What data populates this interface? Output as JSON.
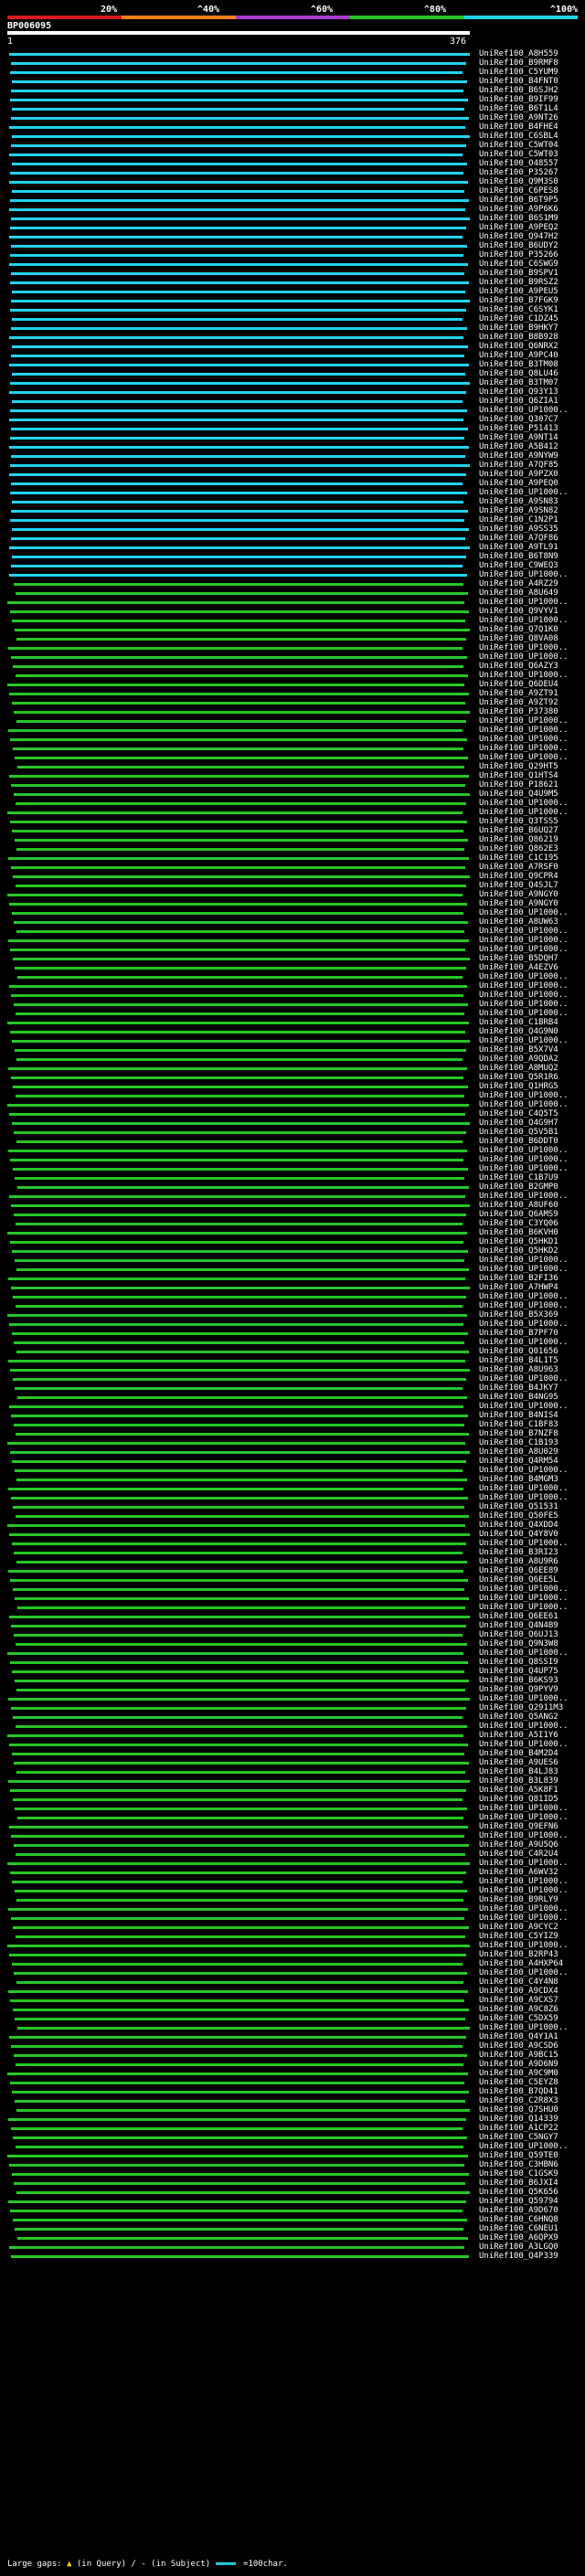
{
  "legend": {
    "labels": [
      "20%",
      "^40%",
      "^60%",
      "^80%",
      "^100%"
    ],
    "colors": [
      "#d81b1b",
      "#f08018",
      "#a93ad0",
      "#26c626",
      "#1fd3ee"
    ]
  },
  "query": {
    "name": "BP006095",
    "ruler_start": "1",
    "ruler_end": "376"
  },
  "hits": [
    "UniRef100_A8H559",
    "UniRef100_B9RMF8",
    "UniRef100_C5YUM9",
    "UniRef100_B4FNT0",
    "UniRef100_B6SJH2",
    "UniRef100_B9IF99",
    "UniRef100_B6T1L4",
    "UniRef100_A9NT26",
    "UniRef100_B4FHE4",
    "UniRef100_C6SBL4",
    "UniRef100_C5WT04",
    "UniRef100_C5WT03",
    "UniRef100_O48557",
    "UniRef100_P35267",
    "UniRef100_Q9M3S0",
    "UniRef100_C6PES8",
    "UniRef100_B6T9P5",
    "UniRef100_A9P6K6",
    "UniRef100_B6S1M9",
    "UniRef100_A9PEQ2",
    "UniRef100_Q947H2",
    "UniRef100_B6UDY2",
    "UniRef100_P35266",
    "UniRef100_C6SWG9",
    "UniRef100_B9SPV1",
    "UniRef100_B9RSZ2",
    "UniRef100_A9PEU5",
    "UniRef100_B7FGK9",
    "UniRef100_C6SYK1",
    "UniRef100_C1DZ45",
    "UniRef100_B9HKY7",
    "UniRef100_B8B928",
    "UniRef100_Q6NRX2",
    "UniRef100_A9PC40",
    "UniRef100_B3TM08",
    "UniRef100_Q8LU46",
    "UniRef100_B3TM07",
    "UniRef100_Q93Y13",
    "UniRef100_Q6ZIA1",
    "UniRef100_UP1000..",
    "UniRef100_Q307C7",
    "UniRef100_P51413",
    "UniRef100_A9NT14",
    "UniRef100_A5B412",
    "UniRef100_A9NYW9",
    "UniRef100_A7QF85",
    "UniRef100_A9PZX0",
    "UniRef100_A9PEQ0",
    "UniRef100_UP1000..",
    "UniRef100_A9SN83",
    "UniRef100_A9SN82",
    "UniRef100_C1N2P1",
    "UniRef100_A9SS35",
    "UniRef100_A7QF86",
    "UniRef100_A9TL91",
    "UniRef100_B6T8N9",
    "UniRef100_C9WEQ3",
    "UniRef100_UP1000..",
    "UniRef100_A4RZ29",
    "UniRef100_A8U649",
    "UniRef100_UP1000..",
    "UniRef100_Q9VYV1",
    "UniRef100_UP1000..",
    "UniRef100_Q7Q1K0",
    "UniRef100_Q8VA08",
    "UniRef100_UP1000..",
    "UniRef100_UP1000..",
    "UniRef100_Q6AZY3",
    "UniRef100_UP1000..",
    "UniRef100_Q6DEU4",
    "UniRef100_A9ZT91",
    "UniRef100_A9ZT92",
    "UniRef100_P37380",
    "UniRef100_UP1000..",
    "UniRef100_UP1000..",
    "UniRef100_UP1000..",
    "UniRef100_UP1000..",
    "UniRef100_UP1000..",
    "UniRef100_Q29HT5",
    "UniRef100_Q1HTS4",
    "UniRef100_P18621",
    "UniRef100_Q4U9M5",
    "UniRef100_UP1000..",
    "UniRef100_UP1000..",
    "UniRef100_Q3TSS5",
    "UniRef100_B6UQ27",
    "UniRef100_Q86219",
    "UniRef100_Q862E3",
    "UniRef100_C1C195",
    "UniRef100_A7RSF0",
    "UniRef100_Q9CPR4",
    "UniRef100_Q4SJL7",
    "UniRef100_A9NGY0",
    "UniRef100_A9NGY0",
    "UniRef100_UP1000..",
    "UniRef100_A8UW63",
    "UniRef100_UP1000..",
    "UniRef100_UP1000..",
    "UniRef100_UP1000..",
    "UniRef100_B5DQH7",
    "UniRef100_A4EZV6",
    "UniRef100_UP1000..",
    "UniRef100_UP1000..",
    "UniRef100_UP1000..",
    "UniRef100_UP1000..",
    "UniRef100_UP1000..",
    "UniRef100_C1BRB4",
    "UniRef100_Q4G9N0",
    "UniRef100_UP1000..",
    "UniRef100_B5X7V4",
    "UniRef100_A9QDA2",
    "UniRef100_A8MUQ2",
    "UniRef100_Q5R1R6",
    "UniRef100_Q1HRG5",
    "UniRef100_UP1000..",
    "UniRef100_UP1000..",
    "UniRef100_C4Q5T5",
    "UniRef100_Q4G9H7",
    "UniRef100_Q5V5B1",
    "UniRef100_B6DDT0",
    "UniRef100_UP1000..",
    "UniRef100_UP1000..",
    "UniRef100_UP1000..",
    "UniRef100_C1B7U9",
    "UniRef100_B2GMP0",
    "UniRef100_UP1000..",
    "UniRef100_A8UF60",
    "UniRef100_Q6AMS9",
    "UniRef100_C3YQ06",
    "UniRef100_B6KVH0",
    "UniRef100_Q5HKD1",
    "UniRef100_Q5HKD2",
    "UniRef100_UP1000..",
    "UniRef100_UP1000..",
    "UniRef100_B2FI36",
    "UniRef100_A7HWP4",
    "UniRef100_UP1000..",
    "UniRef100_UP1000..",
    "UniRef100_B5X369",
    "UniRef100_UP1000..",
    "UniRef100_B7PF70",
    "UniRef100_UP1000..",
    "UniRef100_Q01656",
    "UniRef100_B4L1T5",
    "UniRef100_A8U963",
    "UniRef100_UP1000..",
    "UniRef100_B4JKY7",
    "UniRef100_B4NG95",
    "UniRef100_UP1000..",
    "UniRef100_B4NIS4",
    "UniRef100_C1BF83",
    "UniRef100_B7NZF8",
    "UniRef100_C1B193",
    "UniRef100_A8U029",
    "UniRef100_Q4RM54",
    "UniRef100_UP1000..",
    "UniRef100_B4MGM3",
    "UniRef100_UP1000..",
    "UniRef100_UP1000..",
    "UniRef100_Q51531",
    "UniRef100_Q50FE5",
    "UniRef100_Q4XDD4",
    "UniRef100_Q4Y8V0",
    "UniRef100_UP1000..",
    "UniRef100_B3RI23",
    "UniRef100_A8U9R6",
    "UniRef100_Q6EE89",
    "UniRef100_Q6EE5L",
    "UniRef100_UP1000..",
    "UniRef100_UP1000..",
    "UniRef100_UP1000..",
    "UniRef100_Q6EE61",
    "UniRef100_Q4N4B9",
    "UniRef100_Q6UJ13",
    "UniRef100_Q9N3W8",
    "UniRef100_UP1000..",
    "UniRef100_Q8SSI9",
    "UniRef100_Q4UP75",
    "UniRef100_B6KS93",
    "UniRef100_Q9PYV9",
    "UniRef100_UP1000..",
    "UniRef100_Q2911M3",
    "UniRef100_Q5ANG2",
    "UniRef100_UP1000..",
    "UniRef100_A5I1Y6",
    "UniRef100_UP1000..",
    "UniRef100_B4M2D4",
    "UniRef100_A9UES6",
    "UniRef100_B4LJ83",
    "UniRef100_B3L839",
    "UniRef100_A5K8F1",
    "UniRef100_Q81ID5",
    "UniRef100_UP1000..",
    "UniRef100_UP1000..",
    "UniRef100_Q9EFN6",
    "UniRef100_UP1000..",
    "UniRef100_A9U5Q6",
    "UniRef100_C4R2U4",
    "UniRef100_UP1000..",
    "UniRef100_A6WV32",
    "UniRef100_UP1000..",
    "UniRef100_UP1000..",
    "UniRef100_B9RLY9",
    "UniRef100_UP1000..",
    "UniRef100_UP1000..",
    "UniRef100_A9CYC2",
    "UniRef100_C5YIZ9",
    "UniRef100_UP1000..",
    "UniRef100_B2RP43",
    "UniRef100_A4HXP64",
    "UniRef100_UP1000..",
    "UniRef100_C4Y4N8",
    "UniRef100_A9CDX4",
    "UniRef100_A9CXS7",
    "UniRef100_A9C8Z6",
    "UniRef100_C5DX59",
    "UniRef100_UP1000..",
    "UniRef100_Q4Y1A1",
    "UniRef100_A9CSD6",
    "UniRef100_A9BC15",
    "UniRef100_A9D6N9",
    "UniRef100_A9C9M0",
    "UniRef100_C5EYZ8",
    "UniRef100_B7QD41",
    "UniRef100_C2R8X3",
    "UniRef100_Q7SHU0",
    "UniRef100_Q14339",
    "UniRef100_A1CP22",
    "UniRef100_C5NGY7",
    "UniRef100_UP1000..",
    "UniRef100_Q59TE0",
    "UniRef100_C3HBN6",
    "UniRef100_C1GSK9",
    "UniRef100_B6JXI4",
    "UniRef100_Q5K656",
    "UniRef100_Q59794",
    "UniRef100_A9D670",
    "UniRef100_C6HNQ8",
    "UniRef100_C6NEU1",
    "UniRef100_A6QPX9",
    "UniRef100_A3LGQ0",
    "UniRef100_Q4P339"
  ],
  "footer": {
    "large_gaps_label": "Large gaps:",
    "gap_icon": "▲",
    "in_query": "(in Query)",
    "slash": "/",
    "gap_icon2": "-",
    "in_subject": "(in Subject)",
    "scale_label": "=100char."
  }
}
